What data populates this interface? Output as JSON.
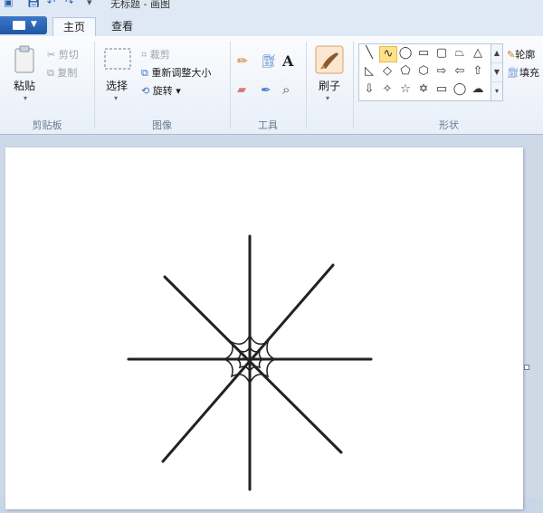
{
  "window": {
    "title": "无标题 - 画图"
  },
  "tabs": [
    {
      "label": "主页",
      "active": true
    },
    {
      "label": "查看",
      "active": false
    }
  ],
  "ribbon": {
    "clipboard": {
      "label": "剪贴板",
      "paste": "粘贴",
      "cut": "剪切",
      "copy": "复制"
    },
    "image": {
      "label": "图像",
      "select": "选择",
      "crop": "裁剪",
      "resize": "重新调整大小",
      "rotate": "旋转"
    },
    "tools": {
      "label": "工具"
    },
    "brushes": {
      "label": "刷子"
    },
    "shapes": {
      "label": "形状",
      "outline": "轮廓",
      "fill": "填充"
    }
  },
  "drawing": {
    "description_colors": {
      "stroke": "#222222",
      "accent": "#fde28a"
    }
  }
}
